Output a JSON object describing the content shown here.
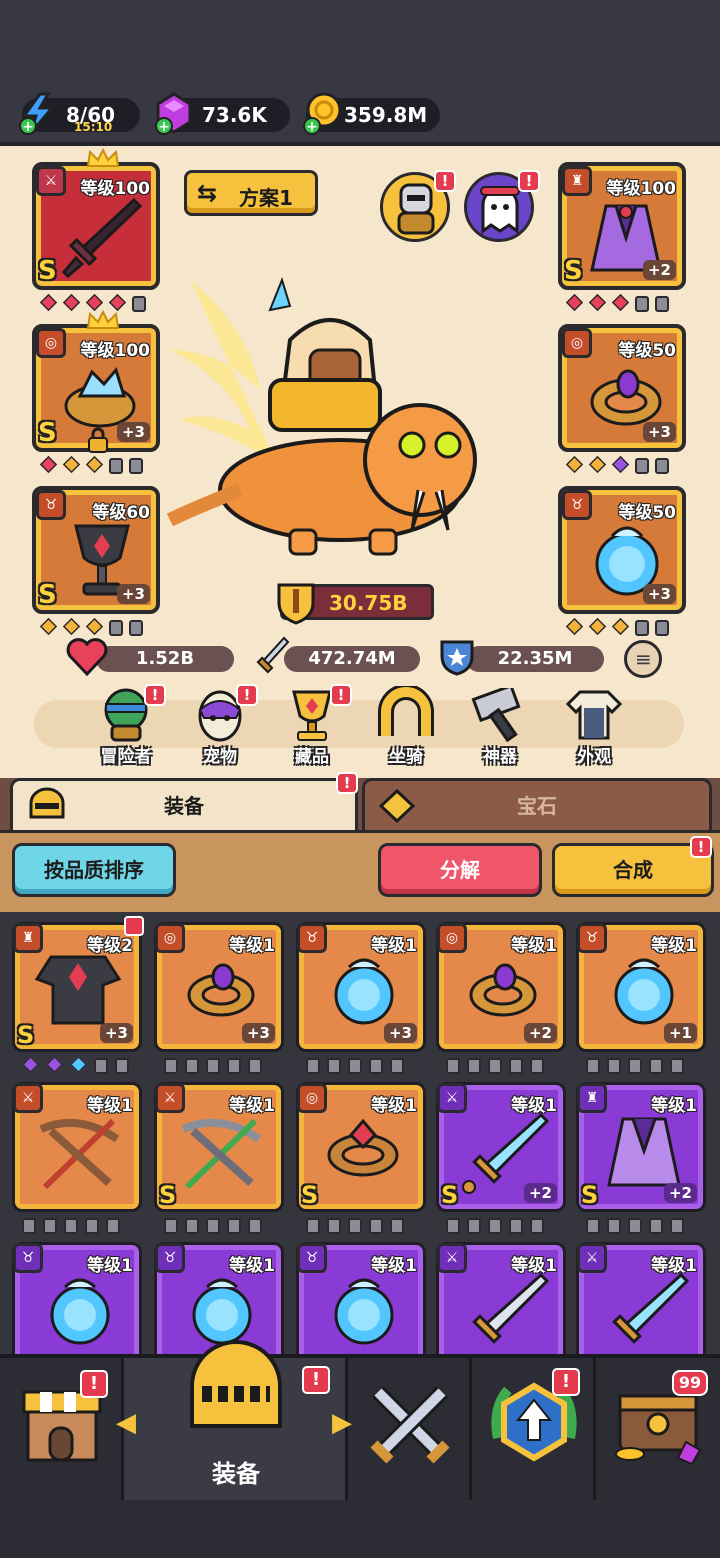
{
  "resources": {
    "energy": {
      "value": "8/60",
      "timer": "15:10"
    },
    "gems": {
      "value": "73.6K"
    },
    "gold": {
      "value": "359.8M"
    }
  },
  "hero": {
    "preset_label": "方案1",
    "power": "30.75B",
    "stats": {
      "hp": "1.52B",
      "attack": "472.74M",
      "defense": "22.35M"
    },
    "left_slots": [
      {
        "level": "等级100",
        "rank": "S",
        "plus": "",
        "color": "red"
      },
      {
        "level": "等级100",
        "rank": "S",
        "plus": "+3",
        "color": "orange"
      },
      {
        "level": "等级60",
        "rank": "S",
        "plus": "+3",
        "color": "orange"
      }
    ],
    "right_slots": [
      {
        "level": "等级100",
        "rank": "S",
        "plus": "+2",
        "color": "orange"
      },
      {
        "level": "等级50",
        "rank": "",
        "plus": "+3",
        "color": "orange"
      },
      {
        "level": "等级50",
        "rank": "",
        "plus": "+3",
        "color": "orange"
      }
    ]
  },
  "nav_icons": [
    {
      "label": "冒险者",
      "badge": "!"
    },
    {
      "label": "宠物",
      "badge": "!"
    },
    {
      "label": "藏品",
      "badge": "!"
    },
    {
      "label": "坐骑",
      "badge": ""
    },
    {
      "label": "神器",
      "badge": ""
    },
    {
      "label": "外观",
      "badge": ""
    }
  ],
  "tabs": {
    "equipment": "装备",
    "gems": "宝石",
    "equipment_badge": "!"
  },
  "actions": {
    "sort": "按品质排序",
    "dismantle": "分解",
    "merge": "合成",
    "merge_badge": "!"
  },
  "inventory": [
    {
      "level": "等级2",
      "rank": "S",
      "plus": "+3",
      "rarity": "orange"
    },
    {
      "level": "等级1",
      "rank": "",
      "plus": "+3",
      "rarity": "orange"
    },
    {
      "level": "等级1",
      "rank": "",
      "plus": "+3",
      "rarity": "orange"
    },
    {
      "level": "等级1",
      "rank": "",
      "plus": "+2",
      "rarity": "orange"
    },
    {
      "level": "等级1",
      "rank": "",
      "plus": "+1",
      "rarity": "orange"
    },
    {
      "level": "等级1",
      "rank": "",
      "plus": "",
      "rarity": "orange"
    },
    {
      "level": "等级1",
      "rank": "S",
      "plus": "",
      "rarity": "orange"
    },
    {
      "level": "等级1",
      "rank": "S",
      "plus": "",
      "rarity": "orange"
    },
    {
      "level": "等级1",
      "rank": "S",
      "plus": "+2",
      "rarity": "purple"
    },
    {
      "level": "等级1",
      "rank": "S",
      "plus": "+2",
      "rarity": "purple"
    },
    {
      "level": "等级1",
      "rank": "",
      "plus": "",
      "rarity": "purple"
    },
    {
      "level": "等级1",
      "rank": "",
      "plus": "",
      "rarity": "purple"
    },
    {
      "level": "等级1",
      "rank": "",
      "plus": "",
      "rarity": "purple"
    },
    {
      "level": "等级1",
      "rank": "",
      "plus": "",
      "rarity": "purple"
    },
    {
      "level": "等级1",
      "rank": "",
      "plus": "",
      "rarity": "purple"
    }
  ],
  "bottom_nav": {
    "active_label": "装备",
    "chest_count": "99"
  },
  "colors": {
    "orange_card": "#e4894a",
    "purple_card": "#8a3bd6",
    "gold": "#f6c13c",
    "badge_red": "#e53b4e"
  }
}
